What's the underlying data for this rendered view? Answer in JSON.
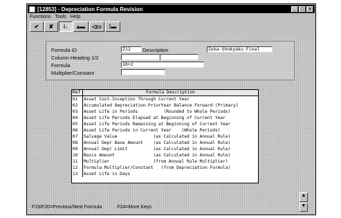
{
  "window": {
    "title": "[12853]  -  Depreciation Formula Revision",
    "controls": [
      "_",
      "□",
      "×"
    ]
  },
  "menu": [
    {
      "label": "Functions"
    },
    {
      "label": "Tools"
    },
    {
      "label": "Help"
    }
  ],
  "toolbar": {
    "buttons": [
      {
        "icon": "check-icon",
        "glyph": "✔"
      },
      {
        "icon": "delete-x-icon",
        "glyph": "✘"
      },
      {
        "icon": "inquire-icon",
        "glyph": "i↓"
      },
      {
        "icon": "add-icon",
        "glyph": "▴▬"
      },
      {
        "icon": "change-icon",
        "glyph": "◁▭"
      },
      {
        "icon": "clear-icon",
        "glyph": "⁞▬"
      }
    ]
  },
  "form": {
    "formula_id_label": "Formula ID",
    "formula_id_value": "Z12",
    "description_label": "Description",
    "description_value": "Zoka-Shokyaku Final",
    "column_heading_label": "Column Heading 1/2",
    "column_heading_1": "",
    "column_heading_2": "",
    "formula_label": "Formula",
    "formula_value": "10+2",
    "multiplier_label": "Multiplier/Constant",
    "multiplier_value": ""
  },
  "grid": {
    "header_ref": "Ref",
    "header_desc": "Formula Description",
    "rows": [
      {
        "ref": "01",
        "desc": "Asset Cost-Inception Through Current Year"
      },
      {
        "ref": "02",
        "desc": "Accumulated Depreciation-PriorYear Balance Forward-(Primary)"
      },
      {
        "ref": "03",
        "desc": "Asset Life in Periods          (Rounded to Whole Periods)"
      },
      {
        "ref": "04",
        "desc": "Asset Life Periods Elapsed at Beginning of Current Year"
      },
      {
        "ref": "05",
        "desc": "Asset Life Periods Remaining at Beginning of Current Year"
      },
      {
        "ref": "06",
        "desc": "Asset Life Periods in Current Year    (Whole Periods)"
      },
      {
        "ref": "07",
        "desc": "Salvage Value              (as Calculated in Annual Rule)"
      },
      {
        "ref": "08",
        "desc": "Annual Depr Base Amount    (as Calculated in Annual Rule)"
      },
      {
        "ref": "09",
        "desc": "Annual Depr Limit          (as Calculated in Annual Rule)"
      },
      {
        "ref": "10",
        "desc": "Basis Amount               (as Calculated in Annual Rule)"
      },
      {
        "ref": "11",
        "desc": "Multiplier                 (from Annual Rule Multiplier)"
      },
      {
        "ref": "12",
        "desc": "Formula Multiplier/Constant   (from Depreciation Formula)"
      },
      {
        "ref": "13",
        "desc": "Asset Life in Days"
      }
    ]
  },
  "status": {
    "item1": "F19/F20=Previous/Next Formula",
    "item2": "F24=More Keys"
  },
  "scroll": {
    "up": "▲",
    "down": "▼"
  }
}
